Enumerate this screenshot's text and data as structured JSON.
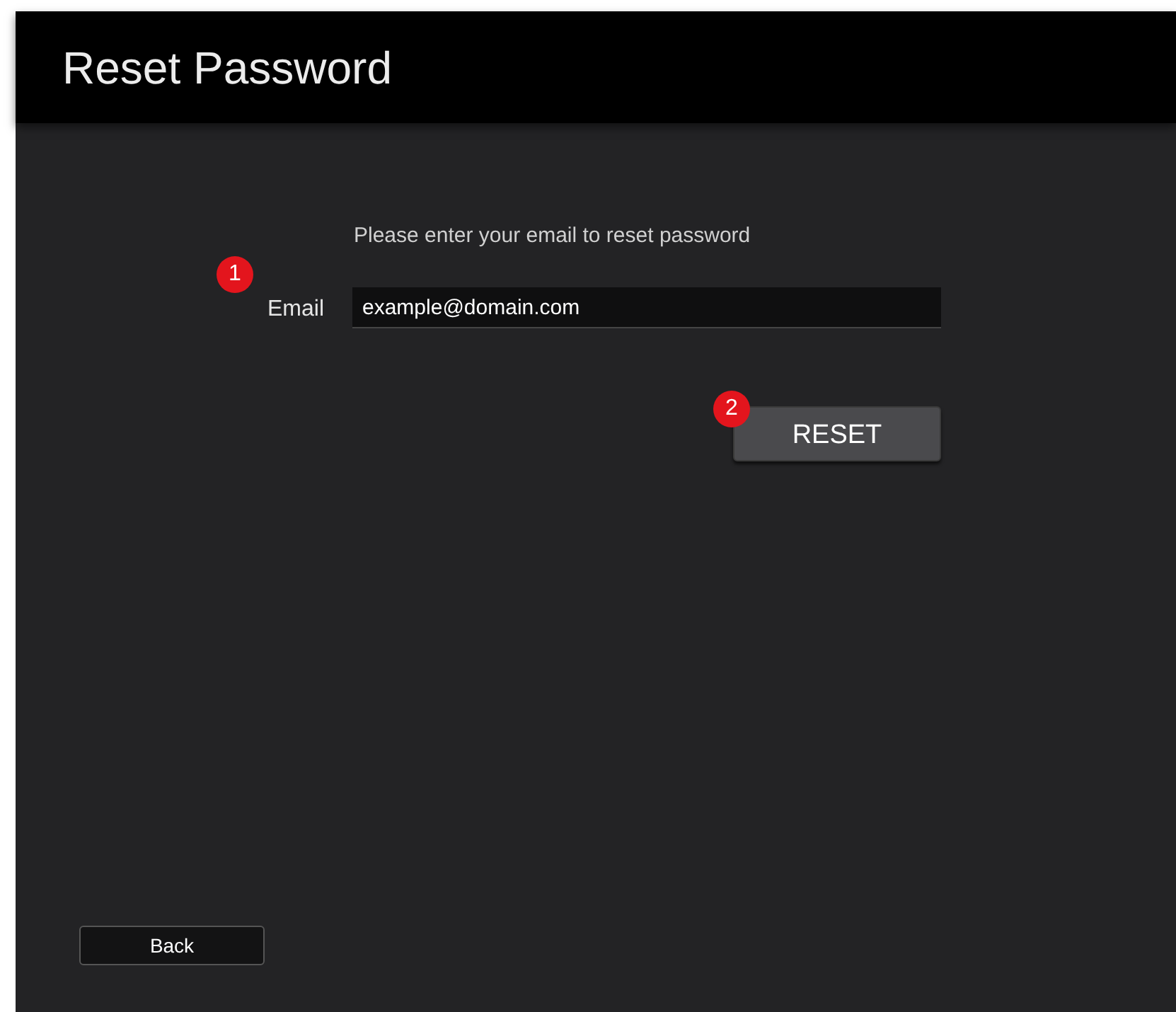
{
  "header": {
    "title": "Reset Password"
  },
  "form": {
    "instruction": "Please enter your email to reset password",
    "email_label": "Email",
    "email_callout": "1",
    "email_value": "example@domain.com",
    "submit_callout": "2",
    "submit": "RESET"
  },
  "footer": {
    "back": "Back"
  }
}
